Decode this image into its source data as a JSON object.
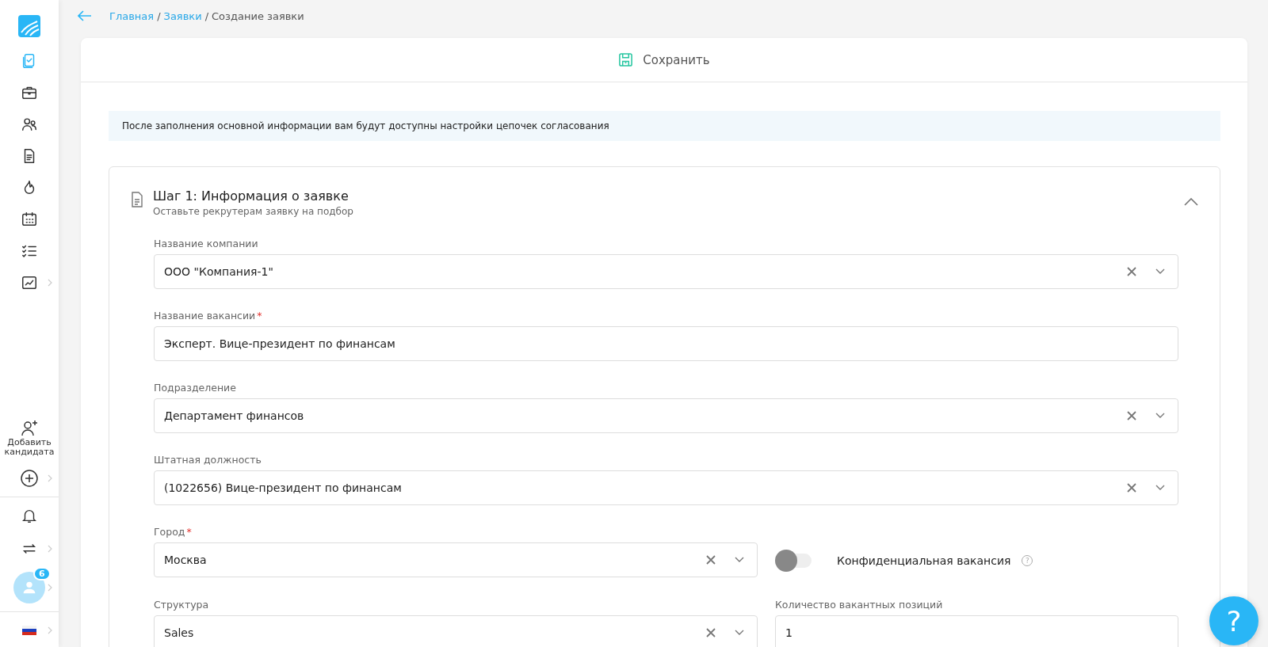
{
  "sidebar": {
    "nav": [
      {
        "selected": true
      },
      {
        "selected": false
      },
      {
        "selected": false
      },
      {
        "selected": false
      },
      {
        "selected": false
      },
      {
        "selected": false
      },
      {
        "selected": false
      },
      {
        "selected": false
      }
    ],
    "add_candidate": "Добавить кандидата",
    "avatar_badge": "6"
  },
  "breadcrumbs": [
    {
      "label": "Главная",
      "link": true
    },
    {
      "label": "Заявки",
      "link": true
    },
    {
      "label": "Создание заявки",
      "link": false
    }
  ],
  "breadcrumb_separators": [
    "/",
    "/"
  ],
  "save_button": "Сохранить",
  "notice": "После заполнения основной информации вам будут доступны настройки цепочек согласования",
  "step": {
    "title": "Шаг 1: Информация о заявке",
    "subtitle": "Оставьте рекрутерам заявку на подбор",
    "expanded": true,
    "rows": [
      [
        {
          "kind": "select",
          "label": "Название компании",
          "value": "ООО \"Компания-1\""
        }
      ],
      [
        {
          "kind": "text",
          "label": "Название вакансии",
          "required_mark": "*",
          "value": "Эксперт. Вице-президент по финансам"
        }
      ],
      [
        {
          "kind": "select",
          "label": "Подразделение",
          "value": "Департамент финансов"
        }
      ],
      [
        {
          "kind": "select",
          "label": "Штатная должность",
          "value": "(1022656) Вице-президент по финансам"
        }
      ],
      [
        {
          "kind": "select",
          "label": "Город",
          "required_mark": "*",
          "value": "Москва"
        },
        {
          "kind": "toggle",
          "label": "Конфиденциальная вакансия",
          "hint": "?",
          "on": false
        }
      ],
      [
        {
          "kind": "select",
          "label": "Структура",
          "value": "Sales"
        },
        {
          "kind": "text",
          "label": "Количество вакантных позиций",
          "value": "1"
        }
      ]
    ]
  },
  "help_button": "?"
}
